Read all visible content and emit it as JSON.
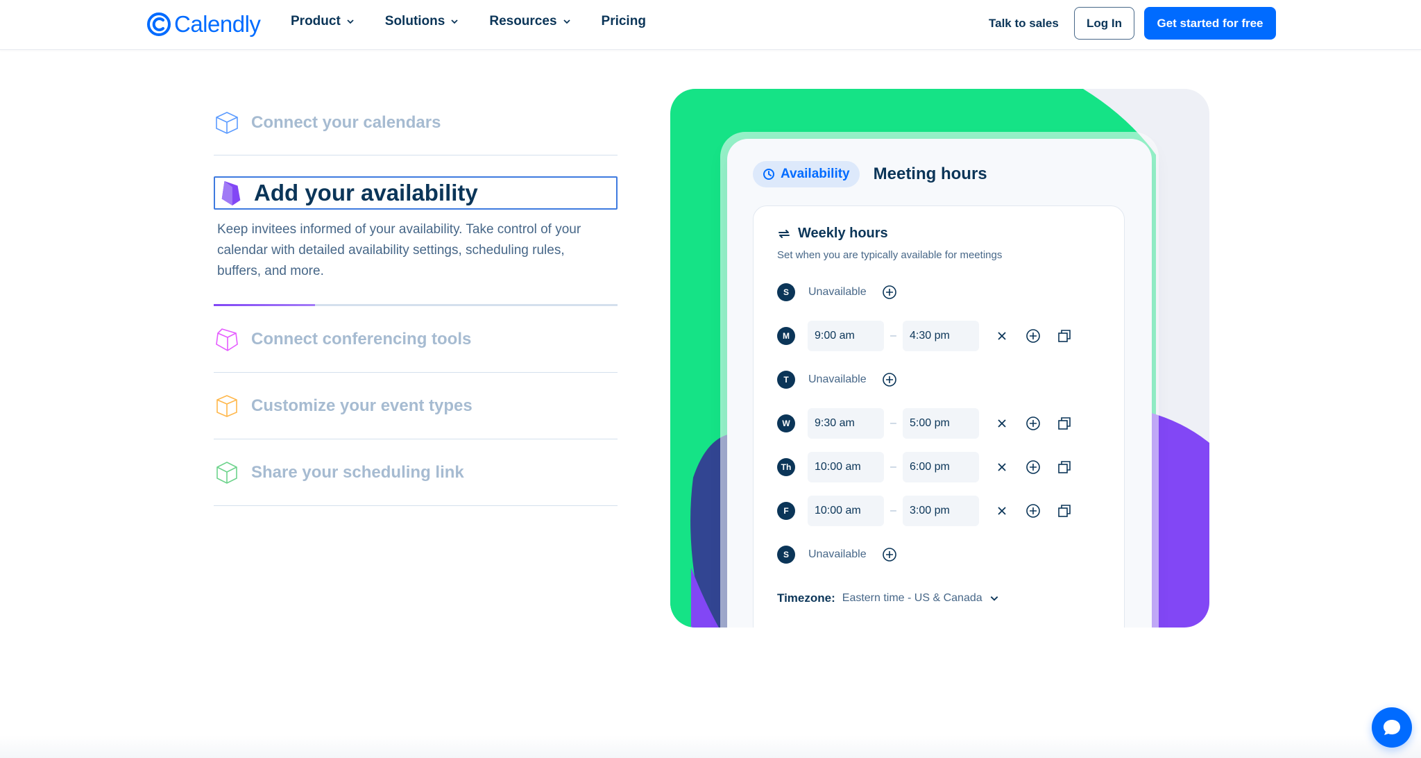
{
  "nav": {
    "logo_text": "Calendly",
    "links": [
      {
        "label": "Product",
        "has_dropdown": true
      },
      {
        "label": "Solutions",
        "has_dropdown": true
      },
      {
        "label": "Resources",
        "has_dropdown": true
      },
      {
        "label": "Pricing",
        "has_dropdown": false
      }
    ],
    "talk_to_sales": "Talk to sales",
    "login": "Log In",
    "cta": "Get started for free"
  },
  "steps": [
    {
      "title": "Connect your calendars",
      "icon": "calendar-cube-icon",
      "color": "#5b9bff"
    },
    {
      "title": "Add your availability",
      "icon": "availability-cube-icon",
      "color": "#8247f5",
      "active": true,
      "description": "Keep invitees informed of your availability. Take control of your calendar with detailed availability settings, scheduling rules, buffers, and more.",
      "progress": 0.25
    },
    {
      "title": "Connect conferencing tools",
      "icon": "conferencing-cube-icon",
      "color": "#e55cff"
    },
    {
      "title": "Customize your event types",
      "icon": "event-types-cube-icon",
      "color": "#ffb74a"
    },
    {
      "title": "Share your scheduling link",
      "icon": "share-link-cube-icon",
      "color": "#6dd38c"
    }
  ],
  "card": {
    "pill_label": "Availability",
    "header": "Meeting hours",
    "weekly_title": "Weekly hours",
    "weekly_sub": "Set when you are typically available for meetings",
    "days": [
      {
        "day": "S",
        "unavailable": "Unavailable"
      },
      {
        "day": "M",
        "start": "9:00 am",
        "end": "4:30 pm"
      },
      {
        "day": "T",
        "unavailable": "Unavailable"
      },
      {
        "day": "W",
        "start": "9:30 am",
        "end": "5:00 pm"
      },
      {
        "day": "Th",
        "start": "10:00 am",
        "end": "6:00 pm"
      },
      {
        "day": "F",
        "start": "10:00 am",
        "end": "3:00 pm"
      },
      {
        "day": "S",
        "unavailable": "Unavailable"
      }
    ],
    "dash": "–",
    "timezone_label": "Timezone:",
    "timezone_value": "Eastern time - US & Canada"
  },
  "colors": {
    "brand": "#006bff",
    "navy": "#0b3558",
    "green": "#15e386",
    "purple": "#8247f5"
  }
}
